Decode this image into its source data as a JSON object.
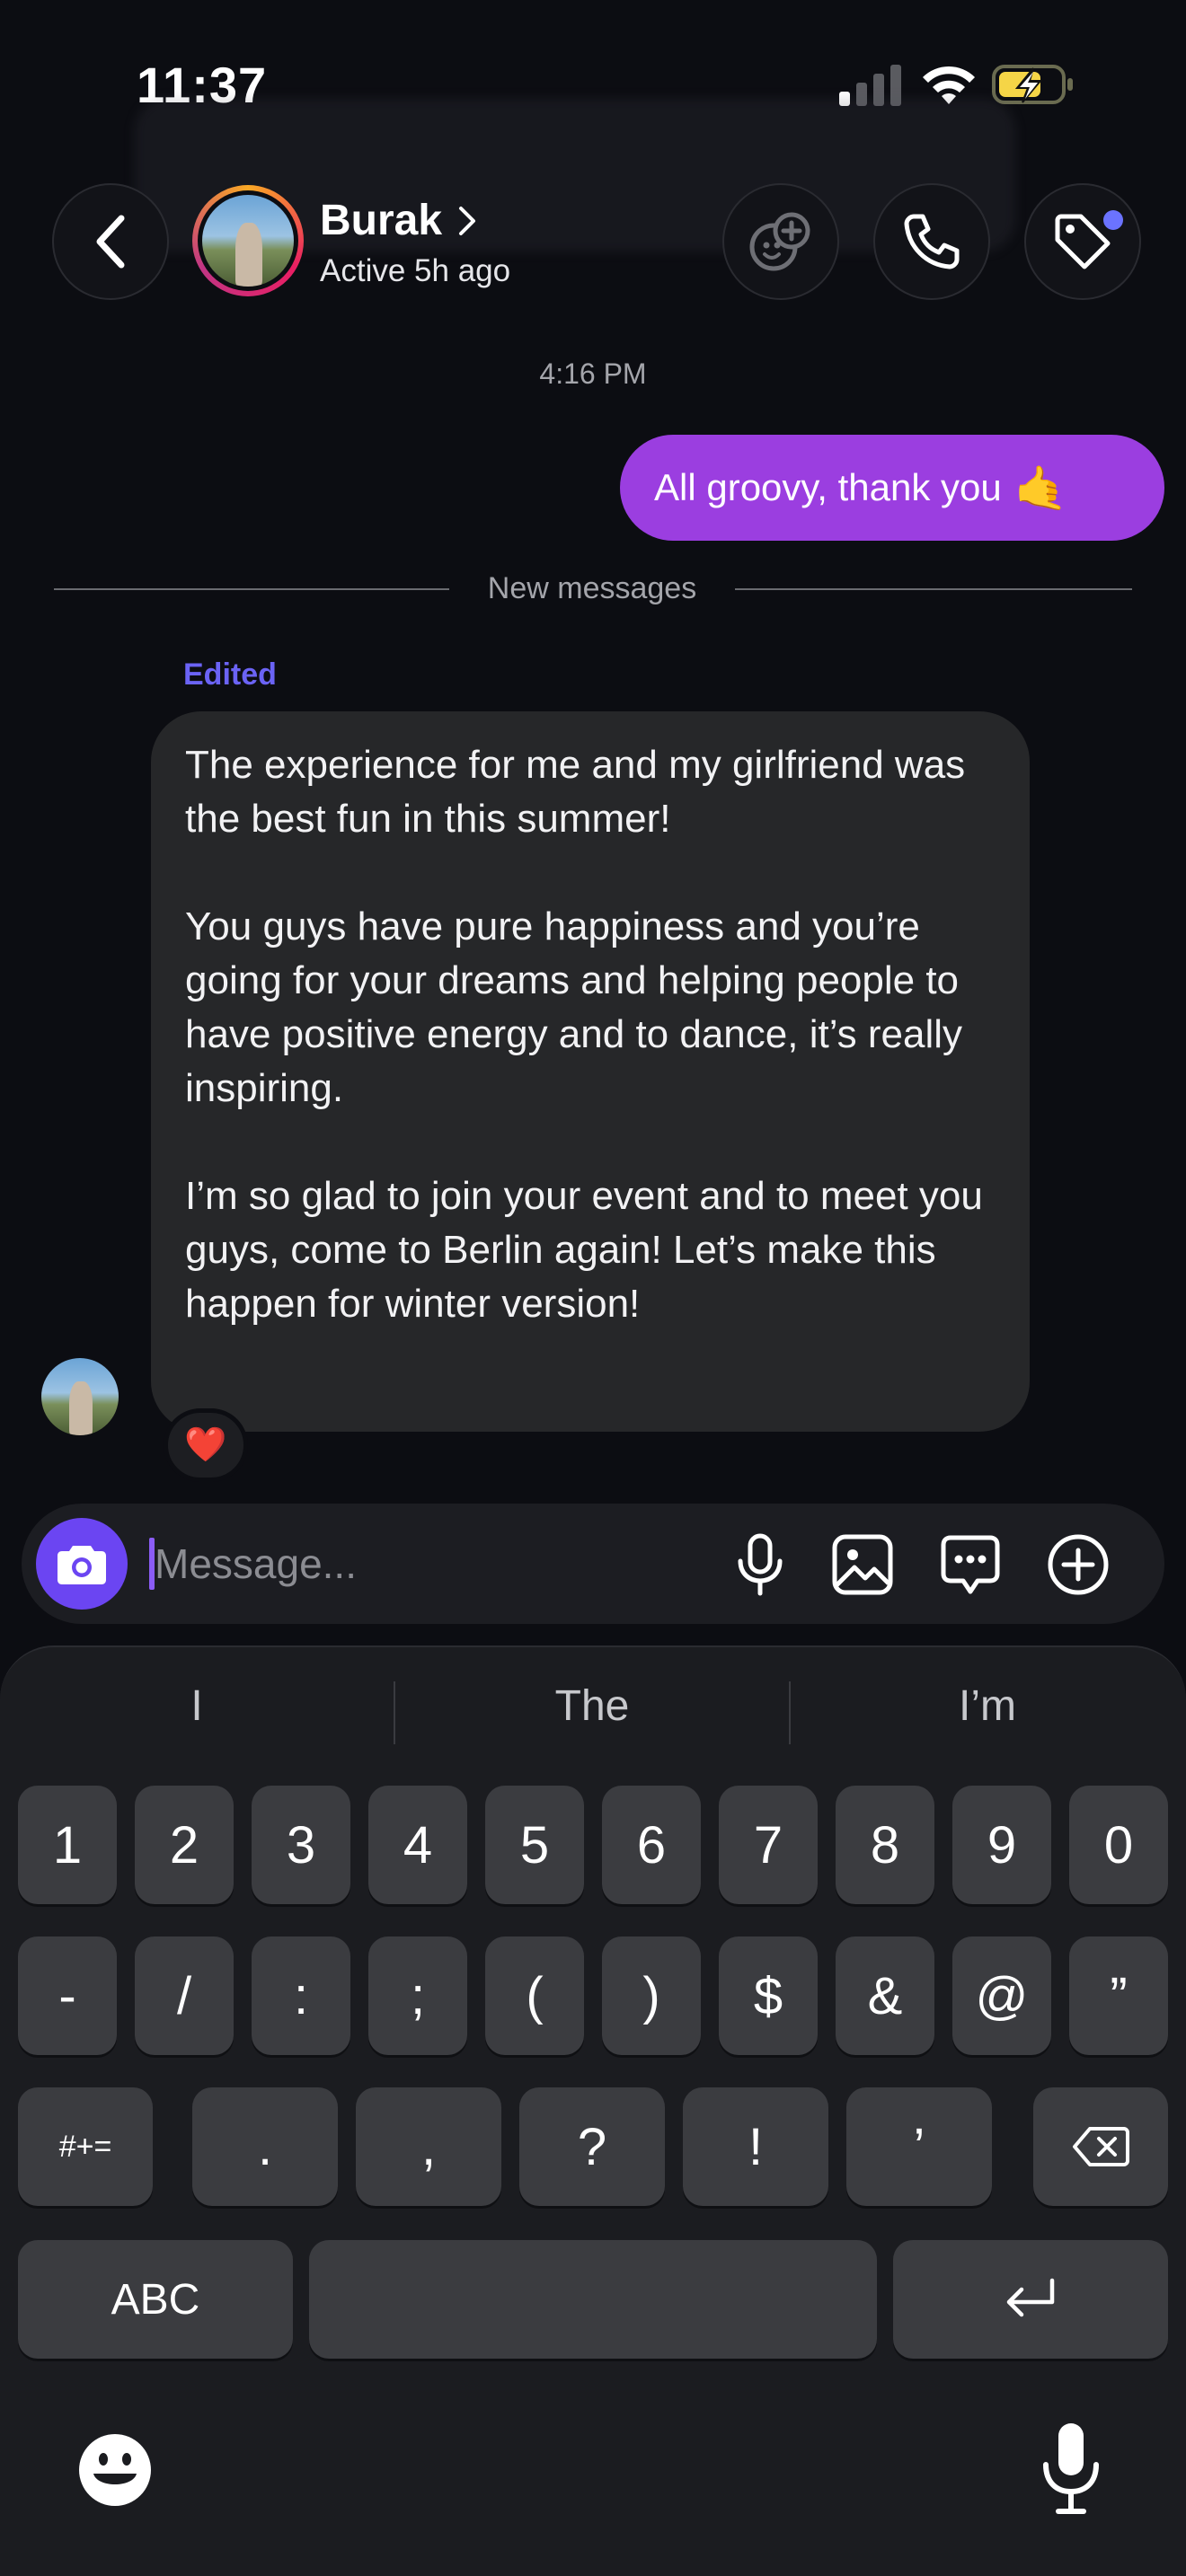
{
  "status_bar": {
    "time": "11:37"
  },
  "header": {
    "contact_name": "Burak",
    "contact_status": "Active 5h ago"
  },
  "chat": {
    "timestamp": "4:16 PM",
    "outgoing_message": "All groovy, thank you",
    "outgoing_emoji": "🤙",
    "divider_label": "New messages",
    "edited_label": "Edited",
    "incoming_paragraphs": [
      "The experience for me and my girlfriend was the best fun in this summer!",
      "You guys have pure happiness and you’re going for your dreams and helping people to have positive energy and to dance, it’s really inspiring.",
      "I’m so glad to join your event and to meet you guys, come to Berlin again! Let’s make this happen for winter version!"
    ],
    "reaction": "❤️"
  },
  "composer": {
    "placeholder": "Message..."
  },
  "keyboard": {
    "suggestions": [
      "I",
      "The",
      "I’m"
    ],
    "row1": [
      "1",
      "2",
      "3",
      "4",
      "5",
      "6",
      "7",
      "8",
      "9",
      "0"
    ],
    "row2": [
      "-",
      "/",
      ":",
      ";",
      "(",
      ")",
      "$",
      "&",
      "@",
      "”"
    ],
    "row3_mode": "#+=",
    "row3": [
      ".",
      ",",
      "?",
      "!",
      "’"
    ],
    "abc_label": "ABC"
  },
  "colors": {
    "outgoing_bubble": "#9b3ee0",
    "camera_button": "#6b45f2",
    "edited_label": "#6b63f5",
    "notification_dot": "#6b73ff"
  }
}
